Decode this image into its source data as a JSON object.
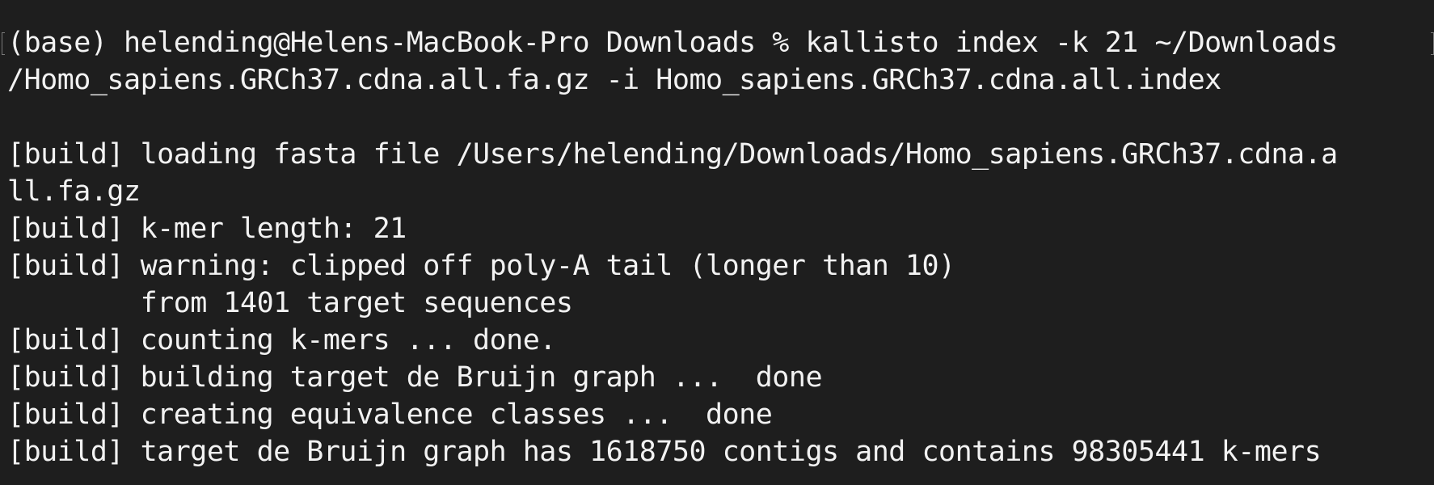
{
  "terminal": {
    "command": {
      "line1": "(base) helending@Helens-MacBook-Pro Downloads % kallisto index -k 21 ~/Downloads",
      "line2": "/Homo_sapiens.GRCh37.cdna.all.fa.gz -i Homo_sapiens.GRCh37.cdna.all.index"
    },
    "output": [
      "[build] loading fasta file /Users/helending/Downloads/Homo_sapiens.GRCh37.cdna.a",
      "ll.fa.gz",
      "[build] k-mer length: 21",
      "[build] warning: clipped off poly-A tail (longer than 10)",
      "        from 1401 target sequences",
      "[build] counting k-mers ... done.",
      "[build] building target de Bruijn graph ...  done",
      "[build] creating equivalence classes ...  done",
      "[build] target de Bruijn graph has 1618750 contigs and contains 98305441 k-mers"
    ]
  }
}
